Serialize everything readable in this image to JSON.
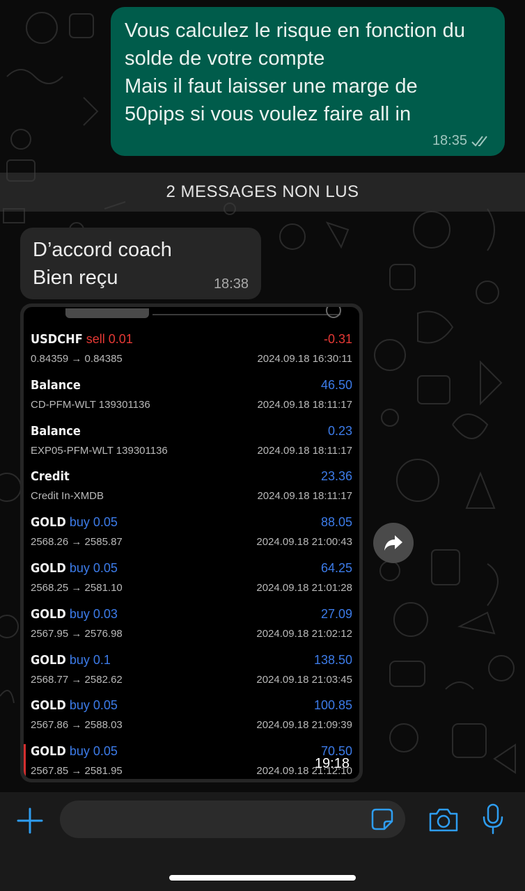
{
  "messages": {
    "outgoing": {
      "text": "Vous calculez le risque en fonction du\nsolde de votre compte\nMais il faut laisser une marge de\n50pips si vous voulez faire all in",
      "time": "18:35"
    },
    "unread_divider": "2 MESSAGES NON LUS",
    "incoming": {
      "text": "D’accord coach\nBien reçu",
      "time": "18:38"
    },
    "image_time": "19:18"
  },
  "trades": [
    {
      "symbol": "USDCHF",
      "action": "sell 0.01",
      "action_type": "sell",
      "amount": "-0.31",
      "amount_sign": "neg",
      "detail": "0.84359 → 0.84385",
      "date": "2024.09.18 16:30:11"
    },
    {
      "symbol": "Balance",
      "action": "",
      "action_type": "",
      "amount": "46.50",
      "amount_sign": "pos",
      "detail": "CD-PFM-WLT 139301136",
      "date": "2024.09.18 18:11:17"
    },
    {
      "symbol": "Balance",
      "action": "",
      "action_type": "",
      "amount": "0.23",
      "amount_sign": "pos",
      "detail": "EXP05-PFM-WLT 139301136",
      "date": "2024.09.18 18:11:17"
    },
    {
      "symbol": "Credit",
      "action": "",
      "action_type": "",
      "amount": "23.36",
      "amount_sign": "pos",
      "detail": "Credit In-XMDB",
      "date": "2024.09.18 18:11:17"
    },
    {
      "symbol": "GOLD",
      "action": "buy 0.05",
      "action_type": "buy",
      "amount": "88.05",
      "amount_sign": "pos",
      "detail": "2568.26 → 2585.87",
      "date": "2024.09.18 21:00:43"
    },
    {
      "symbol": "GOLD",
      "action": "buy 0.05",
      "action_type": "buy",
      "amount": "64.25",
      "amount_sign": "pos",
      "detail": "2568.25 → 2581.10",
      "date": "2024.09.18 21:01:28"
    },
    {
      "symbol": "GOLD",
      "action": "buy 0.03",
      "action_type": "buy",
      "amount": "27.09",
      "amount_sign": "pos",
      "detail": "2567.95 → 2576.98",
      "date": "2024.09.18 21:02:12"
    },
    {
      "symbol": "GOLD",
      "action": "buy 0.1",
      "action_type": "buy",
      "amount": "138.50",
      "amount_sign": "pos",
      "detail": "2568.77 → 2582.62",
      "date": "2024.09.18 21:03:45"
    },
    {
      "symbol": "GOLD",
      "action": "buy 0.05",
      "action_type": "buy",
      "amount": "100.85",
      "amount_sign": "pos",
      "detail": "2567.86 → 2588.03",
      "date": "2024.09.18 21:09:39"
    },
    {
      "symbol": "GOLD",
      "action": "buy 0.05",
      "action_type": "buy",
      "amount": "70.50",
      "amount_sign": "pos",
      "detail": "2567.85 → 2581.95",
      "date": "2024.09.18 21:12:10"
    }
  ],
  "icons": {
    "forward": "forward-icon",
    "attach": "plus-icon",
    "sticker": "sticker-icon",
    "camera": "camera-icon",
    "mic": "microphone-icon",
    "read_receipt": "double-check-icon"
  },
  "colors": {
    "outgoing_bubble": "#005c4b",
    "incoming_bubble": "#262626",
    "accent": "#2e9df0",
    "profit": "#3c7be8",
    "loss": "#e53935"
  }
}
